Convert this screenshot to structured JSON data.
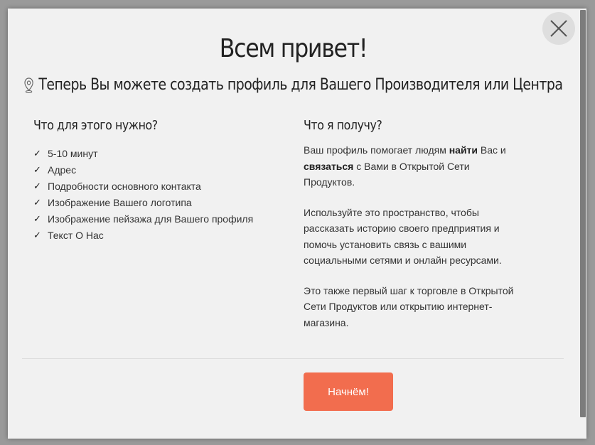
{
  "modal": {
    "title": "Всем привет!",
    "subtitle": "Теперь Вы можете создать профиль для Вашего Производителя или Центра",
    "close_icon": "close-x-icon",
    "pin_icon": "location-pin-icon"
  },
  "left": {
    "heading": "Что для этого нужно?",
    "items": [
      "5-10 минут",
      "Адрес",
      "Подробности основного контакта",
      "Изображение Вашего логотипа",
      "Изображение пейзажа для Вашего профиля",
      "Текст О Нас"
    ],
    "check_icon": "checkmark-icon"
  },
  "right": {
    "heading": "Что я получу?",
    "p1_a": "Ваш профиль помогает людям ",
    "p1_b": "найти",
    "p1_c": " Вас и ",
    "p1_d": "связаться",
    "p1_e": " с Вами в Открытой Сети Продуктов.",
    "p2": "Используйте это пространство, чтобы рассказать историю своего предприятия и помочь установить связь с вашими социальными сетями и онлайн ресурсами.",
    "p3": "Это также первый шаг к торговле в Открытой Сети Продуктов или открытию интернет-магазина."
  },
  "footer": {
    "start_label": "Начнём!",
    "start_color": "#f26d4e"
  }
}
